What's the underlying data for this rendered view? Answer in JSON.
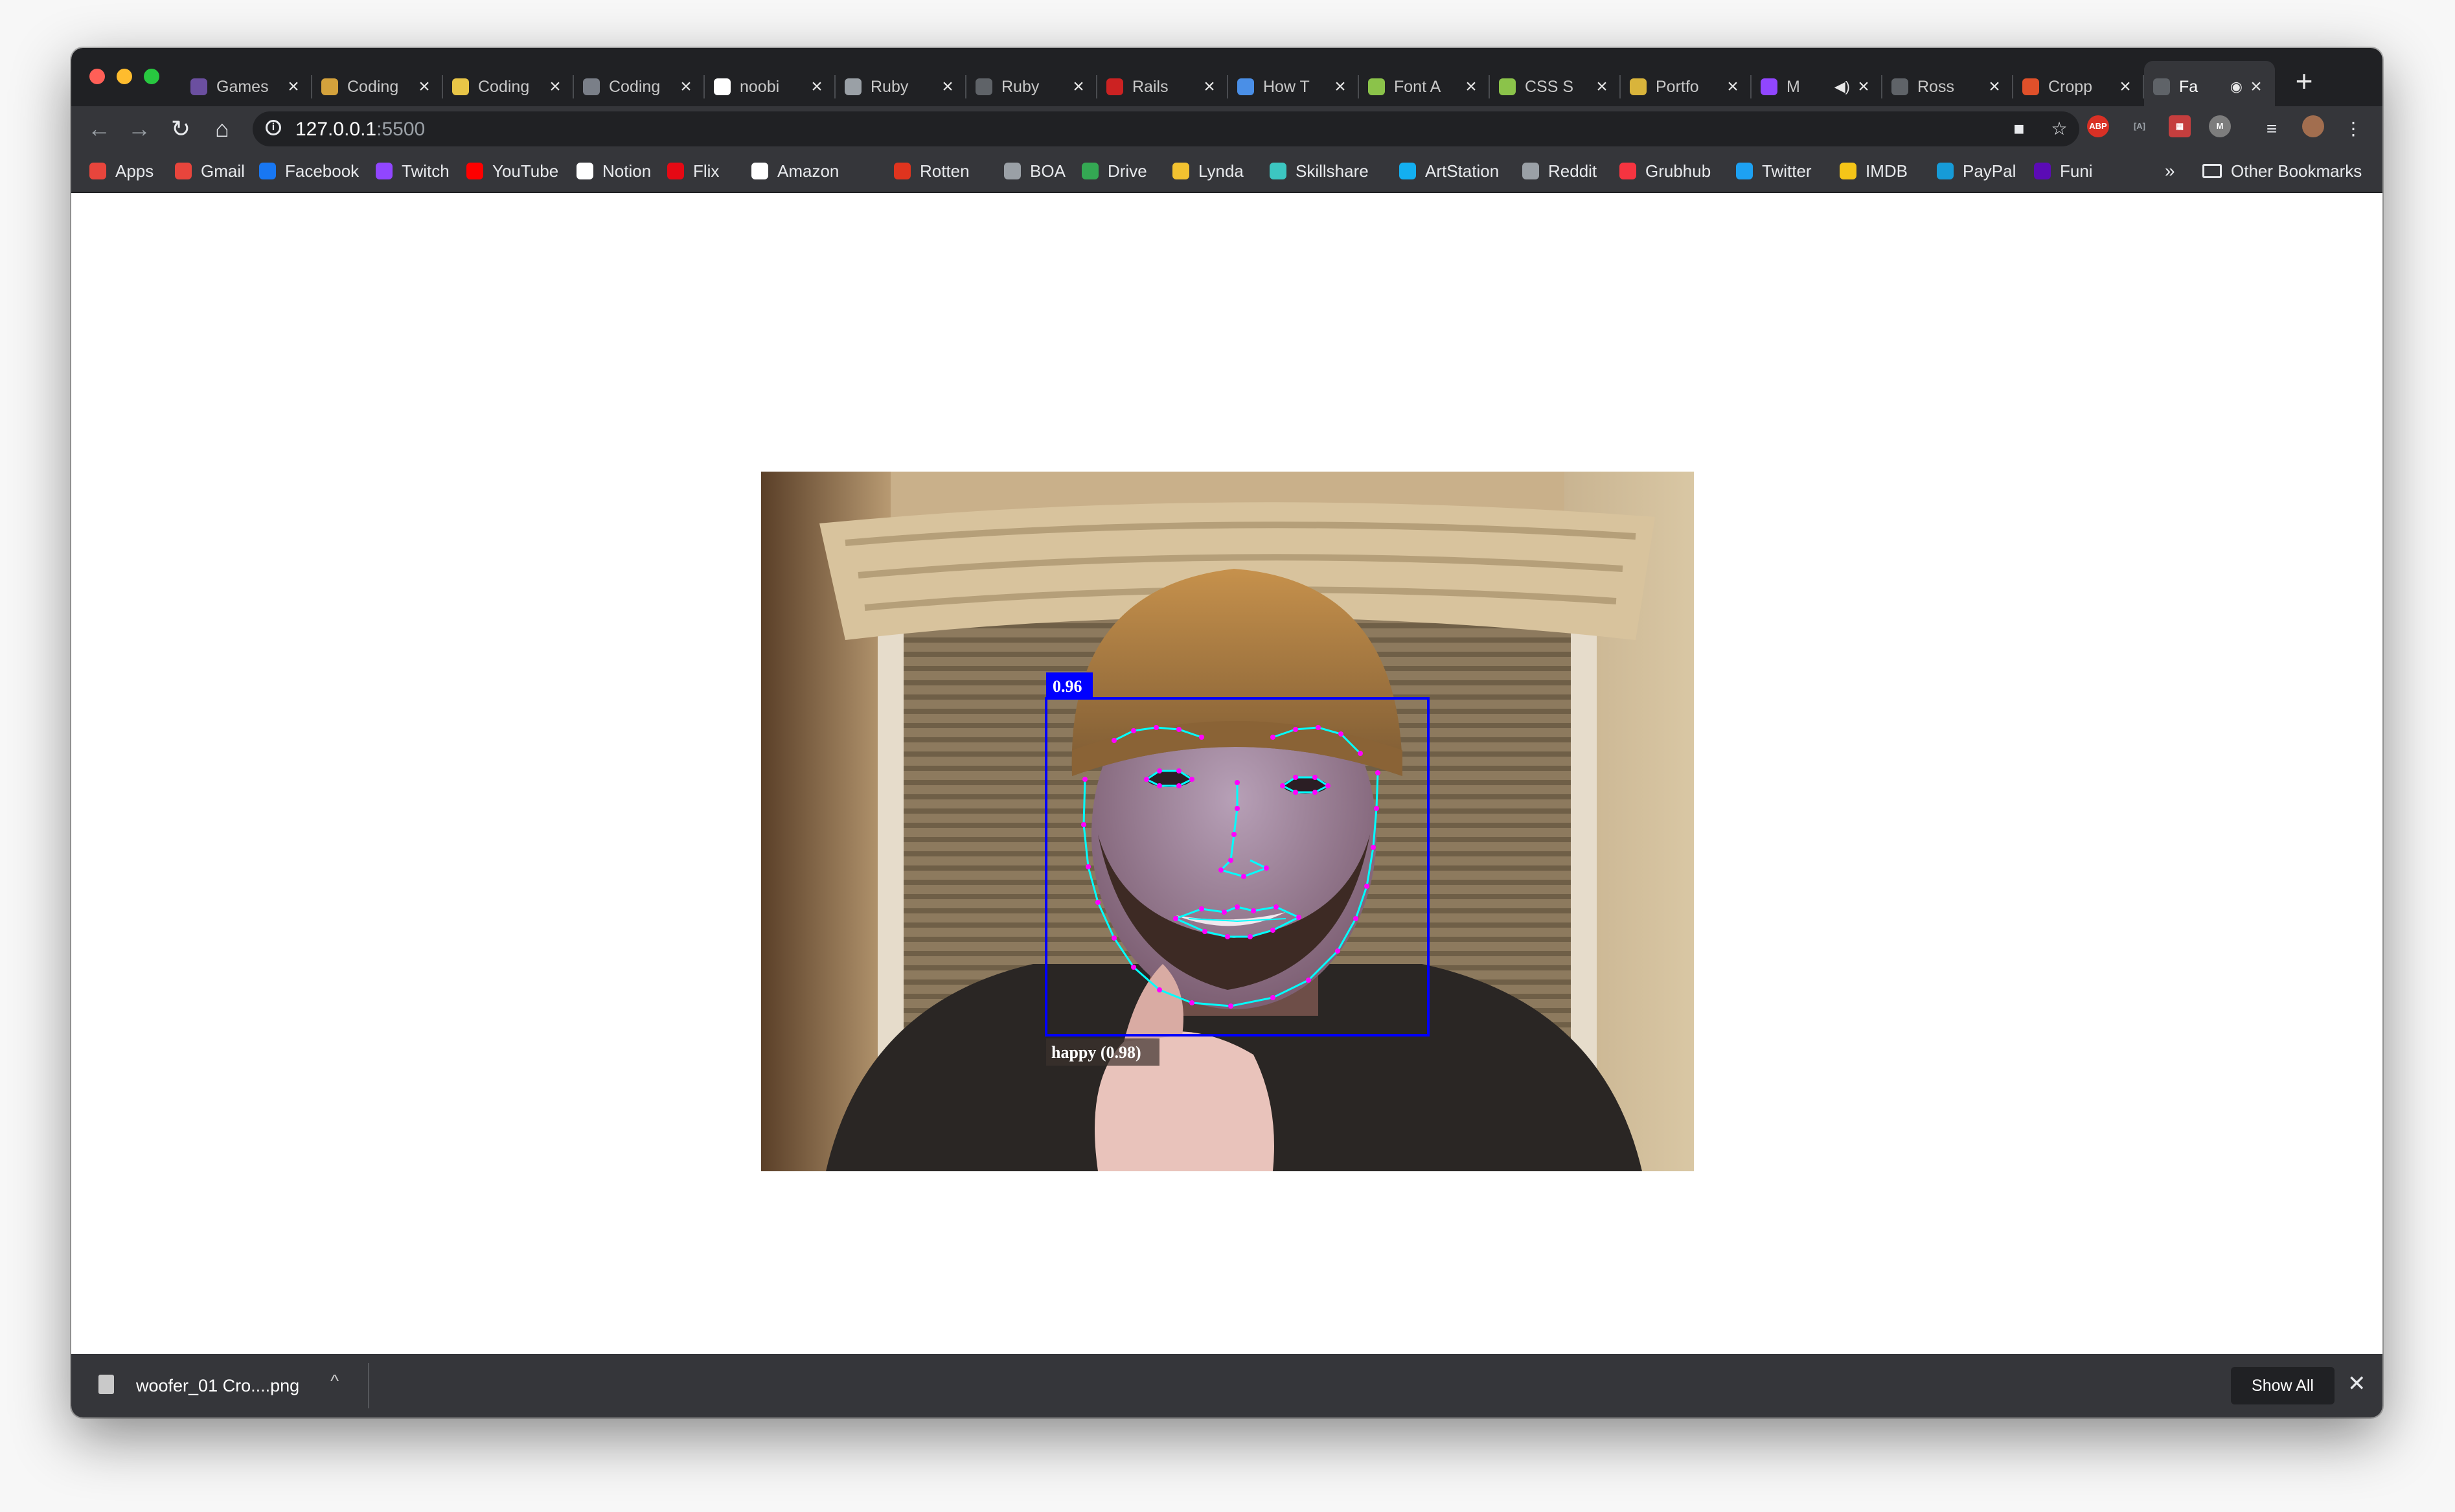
{
  "browser": {
    "tabs": [
      {
        "title": "Games",
        "icon_color": "#6b4fa0",
        "icon_glyph": "👾",
        "icon": "controller-icon"
      },
      {
        "title": "Coding",
        "icon_color": "#d4a23c",
        "icon_glyph": "",
        "icon": "avatar-icon"
      },
      {
        "title": "Coding",
        "icon_color": "#e8c547",
        "icon_glyph": "",
        "icon": "notebook-icon"
      },
      {
        "title": "Coding",
        "icon_color": "#7a7f88",
        "icon_glyph": "",
        "icon": "document-icon"
      },
      {
        "title": "noobi",
        "icon_color": "#ffffff",
        "icon_glyph": "",
        "icon": "github-icon"
      },
      {
        "title": "Ruby",
        "icon_color": "#9aa0a6",
        "icon_glyph": "",
        "icon": "globe-icon"
      },
      {
        "title": "Ruby",
        "icon_color": "#5f6368",
        "icon_glyph": "",
        "icon": "globe-icon"
      },
      {
        "title": "Rails",
        "icon_color": "#cc2222",
        "icon_glyph": "",
        "icon": "rails-icon"
      },
      {
        "title": "How T",
        "icon_color": "#4a8fe7",
        "icon_glyph": "",
        "icon": "dots-icon"
      },
      {
        "title": "Font A",
        "icon_color": "#8bc34a",
        "icon_glyph": "",
        "icon": "font-awesome-icon"
      },
      {
        "title": "CSS S",
        "icon_color": "#8bc34a",
        "icon_glyph": "",
        "icon": "css-icon"
      },
      {
        "title": "Portfo",
        "icon_color": "#d9b43b",
        "icon_glyph": "",
        "icon": "image-icon"
      },
      {
        "title": "M",
        "icon_color": "#9146ff",
        "icon_glyph": "",
        "icon": "twitch-icon",
        "audio": true
      },
      {
        "title": "Ross",
        "icon_color": "#5f6368",
        "icon_glyph": "",
        "icon": "globe-icon"
      },
      {
        "title": "Cropp",
        "icon_color": "#e0502a",
        "icon_glyph": "",
        "icon": "crop-icon"
      },
      {
        "title": "Fa",
        "icon_color": "#5f6368",
        "icon_glyph": "",
        "icon": "globe-icon",
        "active": true,
        "recording": true
      }
    ],
    "new_tab_glyph": "+",
    "nav": {
      "back": "←",
      "forward": "→",
      "reload": "↻",
      "home": "⌂"
    },
    "url_host": "127.0.0.1",
    "url_port": ":5500",
    "bookmarks": [
      {
        "label": "Apps",
        "icon": "apps-grid-icon",
        "color": "#e8453c"
      },
      {
        "label": "Gmail",
        "icon": "gmail-icon",
        "color": "#e8453c"
      },
      {
        "label": "Facebook",
        "icon": "facebook-icon",
        "color": "#1877f2"
      },
      {
        "label": "Twitch",
        "icon": "twitch-icon",
        "color": "#9146ff"
      },
      {
        "label": "YouTube",
        "icon": "youtube-icon",
        "color": "#ff0000"
      },
      {
        "label": "Notion",
        "icon": "notion-icon",
        "color": "#ffffff"
      },
      {
        "label": "Flix",
        "icon": "netflix-icon",
        "color": "#e50914"
      },
      {
        "label": "Amazon",
        "icon": "amazon-icon",
        "color": "#ffffff"
      },
      {
        "label": "Rotten",
        "icon": "tomato-icon",
        "color": "#e0341e"
      },
      {
        "label": "BOA",
        "icon": "globe-icon",
        "color": "#9aa0a6"
      },
      {
        "label": "Drive",
        "icon": "drive-icon",
        "color": "#34a853"
      },
      {
        "label": "Lynda",
        "icon": "lynda-icon",
        "color": "#f2c230"
      },
      {
        "label": "Skillshare",
        "icon": "skillshare-icon",
        "color": "#3cc6c1"
      },
      {
        "label": "ArtStation",
        "icon": "artstation-icon",
        "color": "#13aff0"
      },
      {
        "label": "Reddit",
        "icon": "globe-icon",
        "color": "#9aa0a6"
      },
      {
        "label": "Grubhub",
        "icon": "grubhub-icon",
        "color": "#f63440"
      },
      {
        "label": "Twitter",
        "icon": "twitter-icon",
        "color": "#1da1f2"
      },
      {
        "label": "IMDB",
        "icon": "imdb-icon",
        "color": "#f5c518"
      },
      {
        "label": "PayPal",
        "icon": "paypal-icon",
        "color": "#169bd7"
      },
      {
        "label": "Funi",
        "icon": "funimation-icon",
        "color": "#5b0bb5"
      }
    ],
    "bookmarks_overflow": "»",
    "other_bookmarks": "Other Bookmarks"
  },
  "detection": {
    "score": "0.96",
    "expression": "happy (0.98)",
    "box_color": "#0000ff",
    "landmark_color": "#ff00ff",
    "contour_color": "#00ffff"
  },
  "downloads": {
    "file_name": "woofer_01 Cro....png",
    "chevron": "^",
    "show_all": "Show All",
    "close": "✕"
  }
}
